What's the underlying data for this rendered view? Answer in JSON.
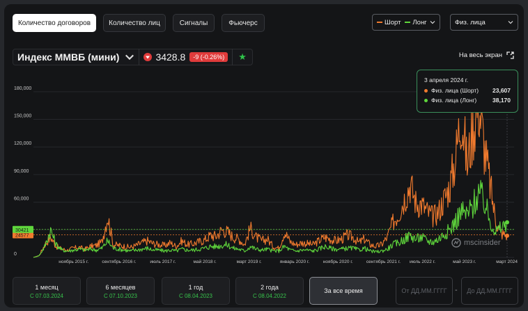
{
  "tabs": [
    {
      "label": "Количество договоров",
      "active": true
    },
    {
      "label": "Количество лиц",
      "active": false
    },
    {
      "label": "Сигналы",
      "active": false
    },
    {
      "label": "Фьючерс",
      "active": false
    }
  ],
  "series_select": {
    "short_label": "Шорт",
    "long_label": "Лонг"
  },
  "person_select": {
    "value": "Физ. лица"
  },
  "instrument": {
    "title": "Индекс ММВБ (мини)",
    "price": "3428.8",
    "delta": "-9 (-0.26%)"
  },
  "fullscreen_label": "На весь экран",
  "tooltip": {
    "date": "3 апреля 2024 г.",
    "short_label": "Физ. лица (Шорт)",
    "short_value": "23,607",
    "long_label": "Физ. лица (Лонг)",
    "long_value": "38,170"
  },
  "watermark": "mscinsider",
  "colors": {
    "short": "#f07a2e",
    "long": "#5fd63c",
    "accent": "#2fc34a",
    "negative": "#e03b3b"
  },
  "periods": [
    {
      "label": "1 месяц",
      "sub": "С 07.03.2024",
      "active": false
    },
    {
      "label": "6 месяцев",
      "sub": "С 07.10.2023",
      "active": false
    },
    {
      "label": "1 год",
      "sub": "С 08.04.2023",
      "active": false
    },
    {
      "label": "2 года",
      "sub": "С 08.04.2022",
      "active": false
    },
    {
      "label": "За все время",
      "sub": "",
      "active": true
    }
  ],
  "date_from_placeholder": "От ДД.ММ.ГГГГ",
  "date_to_placeholder": "До ДД.ММ.ГГГГ",
  "date_sep": "-",
  "chart_data": {
    "type": "line",
    "ylim": [
      0,
      195000
    ],
    "y_ticks": [
      0,
      30000,
      60000,
      90000,
      120000,
      150000,
      180000
    ],
    "y_tick_labels": [
      "0",
      "",
      "60,000",
      "90,000",
      "120,000",
      "150,000",
      "180,000"
    ],
    "x_tick_labels": [
      "ноябрь 2015 г.",
      "сентябрь 2016 г.",
      "июль 2017 г.",
      "май 2018 г.",
      "март 2019 г.",
      "январь 2020 г.",
      "ноябрь 2020 г.",
      "сентябрь 2021 г.",
      "июль 2022 г.",
      "май 2023 г.",
      "март 2024"
    ],
    "x_tick_pos": [
      0.07,
      0.16,
      0.26,
      0.35,
      0.44,
      0.53,
      0.62,
      0.71,
      0.8,
      0.89,
      0.98
    ],
    "current_short": "24577",
    "current_long": "30421",
    "current_short_value": 24577,
    "current_long_value": 30421,
    "series": [
      {
        "name": "Физ. лица (Шорт)",
        "values": [
          0,
          2000,
          14000,
          22000,
          12000,
          9000,
          8000,
          10000,
          11000,
          9000,
          12000,
          13000,
          17000,
          45000,
          14000,
          13000,
          12000,
          11000,
          13000,
          16000,
          18000,
          15000,
          14000,
          13000,
          16000,
          12000,
          18000,
          14000,
          15000,
          17000,
          19000,
          24000,
          23000,
          30000,
          28000,
          22000,
          20000,
          14000,
          32000,
          22000,
          18000,
          20000,
          12000,
          10000,
          28000,
          17000,
          14000,
          16000,
          15000,
          14000,
          18000,
          22000,
          20000,
          18000,
          20000,
          24000,
          22000,
          16000,
          20000,
          14000,
          12000,
          14000,
          22000,
          38000,
          48000,
          64000,
          80000,
          60000,
          58000,
          50000,
          44000,
          50000,
          64000,
          78000,
          110000,
          160000,
          100000,
          140000,
          170000,
          120000,
          80000,
          40000,
          26000,
          23607
        ]
      },
      {
        "name": "Физ. лица (Лонг)",
        "values": [
          0,
          2000,
          12000,
          30000,
          14000,
          8000,
          7000,
          8000,
          9000,
          8000,
          9000,
          8000,
          10000,
          18000,
          10000,
          9000,
          8000,
          7000,
          8000,
          9000,
          10000,
          8000,
          8000,
          7000,
          8000,
          7000,
          9000,
          8000,
          8000,
          9000,
          10000,
          12000,
          12000,
          13000,
          14000,
          10000,
          9000,
          7000,
          12000,
          9000,
          8000,
          9000,
          7000,
          7000,
          12000,
          8000,
          7000,
          8000,
          8000,
          7000,
          9000,
          12000,
          10000,
          9000,
          9000,
          10000,
          10000,
          8000,
          10000,
          7000,
          6000,
          7000,
          9000,
          14000,
          16000,
          20000,
          24000,
          20000,
          22000,
          18000,
          17000,
          20000,
          26000,
          30000,
          40000,
          50000,
          46000,
          56000,
          70000,
          60000,
          40000,
          28000,
          32000,
          38170
        ]
      }
    ]
  }
}
